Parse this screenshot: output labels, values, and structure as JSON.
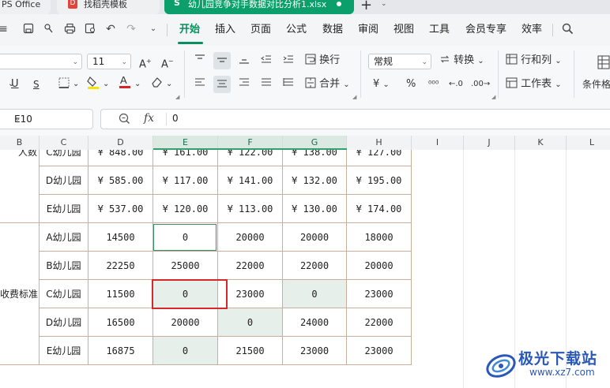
{
  "tabs": {
    "wps": "PS Office",
    "template": "找稻壳模板",
    "file": "幼儿园竞争对手数据对比分析1.xlsx",
    "file_icon": "S",
    "template_icon": "D"
  },
  "menu": [
    "开始",
    "插入",
    "页面",
    "公式",
    "数据",
    "审阅",
    "视图",
    "工具",
    "会员专享",
    "效率"
  ],
  "ribbon": {
    "font_size": "11",
    "number_format": "常规",
    "wrap": "换行",
    "convert": "转换",
    "merge": "合并",
    "row_col": "行和列",
    "worksheet": "工作表",
    "cond_format": "条件格",
    "currency": "¥",
    "percent": "%"
  },
  "formula_bar": {
    "name_box": "E10",
    "fx": "fx",
    "value": "0"
  },
  "columns": [
    "B",
    "C",
    "D",
    "E",
    "F",
    "G",
    "H",
    "I",
    "J",
    "K",
    "L"
  ],
  "group1_label": "人数",
  "group2_label": "收费标准",
  "rows_top": [
    {
      "name": "C幼儿园",
      "d": "¥ 848.00",
      "e": "¥ 161.00",
      "f": "¥ 122.00",
      "g": "¥ 138.00",
      "h": "¥ 127.00"
    },
    {
      "name": "D幼儿园",
      "d": "¥ 585.00",
      "e": "¥ 117.00",
      "f": "¥ 141.00",
      "g": "¥ 132.00",
      "h": "¥ 195.00"
    },
    {
      "name": "E幼儿园",
      "d": "¥ 537.00",
      "e": "¥ 120.00",
      "f": "¥ 113.00",
      "g": "¥ 130.00",
      "h": "¥ 174.00"
    }
  ],
  "rows_fee": [
    {
      "name": "A幼儿园",
      "d": "14500",
      "e": "0",
      "f": "20000",
      "g": "20000",
      "h": "18000"
    },
    {
      "name": "B幼儿园",
      "d": "22250",
      "e": "25000",
      "f": "22000",
      "g": "22000",
      "h": "20000"
    },
    {
      "name": "C幼儿园",
      "d": "11500",
      "e": "0",
      "f": "23000",
      "g": "0",
      "h": "23000"
    },
    {
      "name": "D幼儿园",
      "d": "16500",
      "e": "20000",
      "f": "0",
      "g": "24000",
      "h": "22000"
    },
    {
      "name": "E幼儿园",
      "d": "16875",
      "e": "0",
      "f": "21500",
      "g": "23000",
      "h": "23000"
    }
  ],
  "watermark": {
    "text": "极光下载站",
    "url": "www.xz7.com"
  }
}
